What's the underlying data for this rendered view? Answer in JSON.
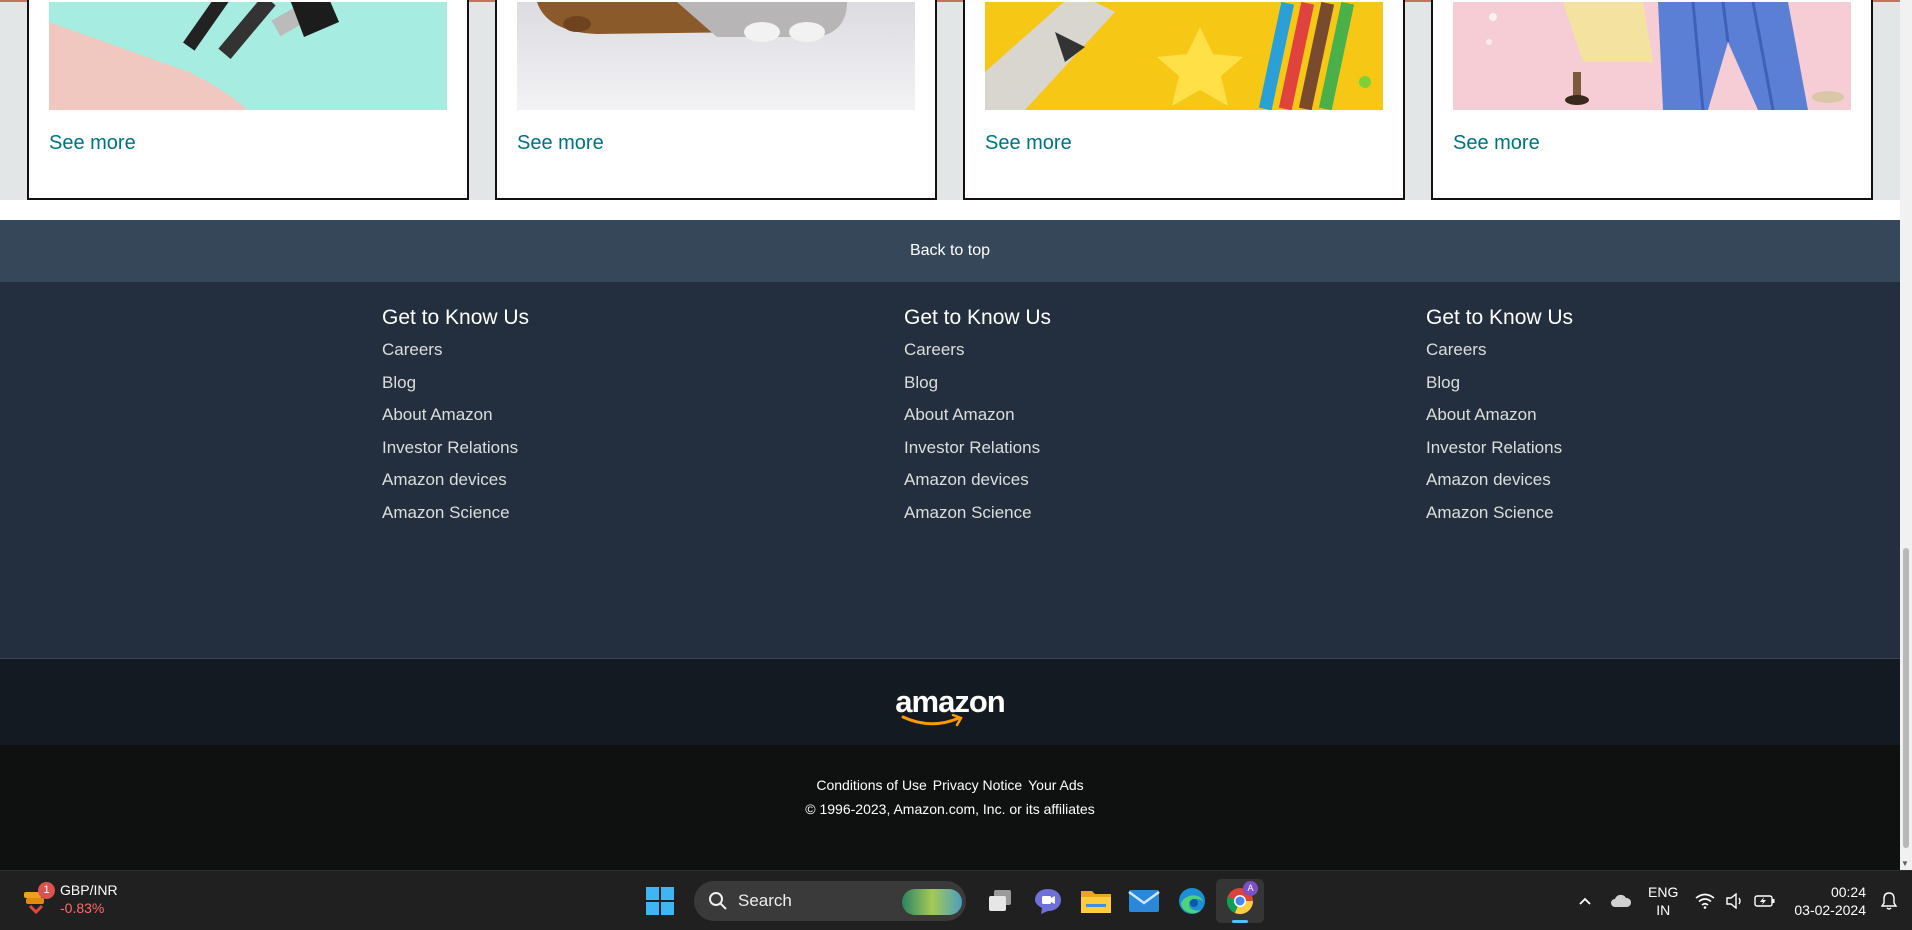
{
  "cards": [
    {
      "see_more": "See more"
    },
    {
      "see_more": "See more"
    },
    {
      "see_more": "See more"
    },
    {
      "see_more": "See more"
    }
  ],
  "back_to_top": "Back to top",
  "footer_columns": [
    {
      "heading": "Get to Know Us",
      "links": [
        "Careers",
        "Blog",
        "About Amazon",
        "Investor Relations",
        "Amazon devices",
        "Amazon Science"
      ]
    },
    {
      "heading": "Get to Know Us",
      "links": [
        "Careers",
        "Blog",
        "About Amazon",
        "Investor Relations",
        "Amazon devices",
        "Amazon Science"
      ]
    },
    {
      "heading": "Get to Know Us",
      "links": [
        "Careers",
        "Blog",
        "About Amazon",
        "Investor Relations",
        "Amazon devices",
        "Amazon Science"
      ]
    }
  ],
  "logo_text": "amazon",
  "legal": {
    "links": [
      "Conditions of Use",
      "Privacy Notice",
      "Your Ads"
    ],
    "copyright": "© 1996-2023, Amazon.com, Inc. or its affiliates"
  },
  "taskbar": {
    "widget": {
      "badge": "1",
      "pair": "GBP/INR",
      "change": "-0.83%"
    },
    "search_label": "Search",
    "lang_line1": "ENG",
    "lang_line2": "IN",
    "time": "00:24",
    "date": "03-02-2024",
    "apps": [
      "task-view",
      "teams-chat",
      "file-explorer",
      "mail",
      "edge",
      "chrome"
    ],
    "chrome_profile_badge": "A"
  },
  "colors": {
    "link": "#007185",
    "back_to_top_bg": "#37475a",
    "footer_bg": "#232f3e",
    "logo_band_bg": "#131a22",
    "legal_bg": "#0f1111",
    "logo_smile": "#ff9900"
  }
}
